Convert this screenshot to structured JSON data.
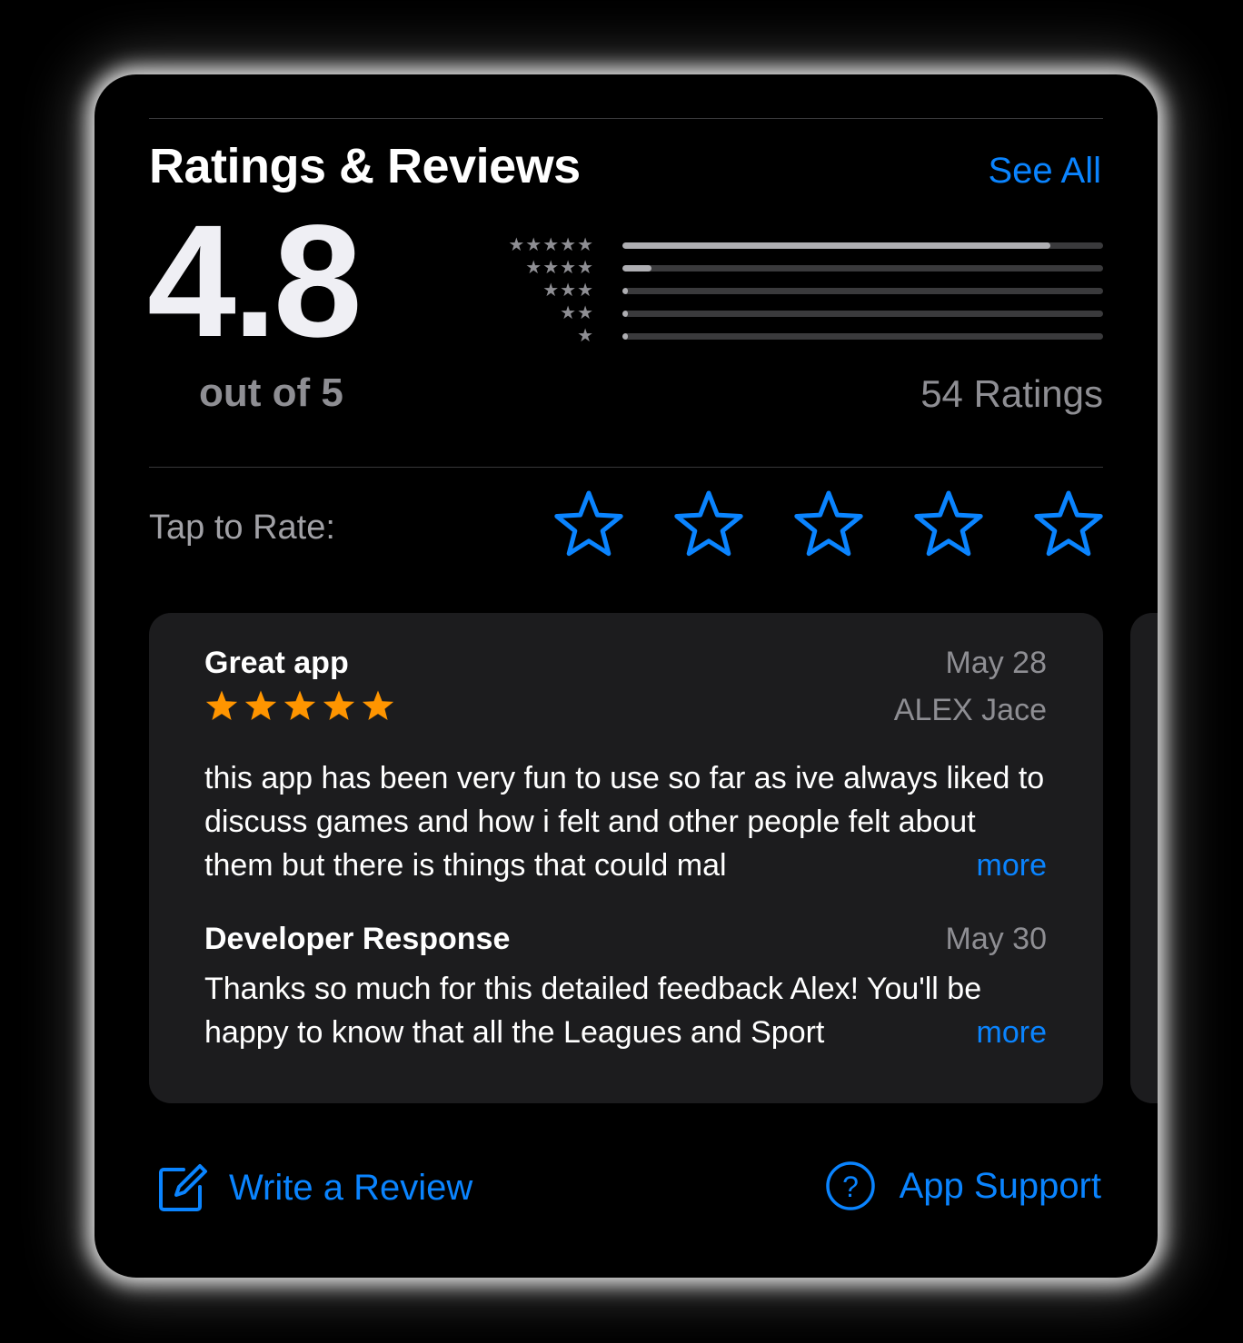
{
  "section": {
    "title": "Ratings & Reviews",
    "see_all_label": "See All"
  },
  "summary": {
    "average": "4.8",
    "out_of_label": "out of 5",
    "count_label": "54 Ratings",
    "distribution": [
      {
        "stars": 5,
        "fraction": 0.89
      },
      {
        "stars": 4,
        "fraction": 0.06
      },
      {
        "stars": 3,
        "fraction": 0.012
      },
      {
        "stars": 2,
        "fraction": 0.012
      },
      {
        "stars": 1,
        "fraction": 0.012
      }
    ]
  },
  "tap_to_rate": {
    "label": "Tap to Rate:",
    "star_count": 5
  },
  "review": {
    "title": "Great app",
    "date": "May 28",
    "author": "ALEX Jace",
    "rating": 5,
    "body": "this app has been very fun to use so far as ive always liked to discuss games and how i felt and other people felt about them but there is things that could mal",
    "more_label": "more",
    "developer_response": {
      "title": "Developer Response",
      "date": "May 30",
      "body": "Thanks so much for this detailed feedback Alex! You'll be happy to know that all the Leagues and Sport",
      "more_label": "more"
    }
  },
  "actions": {
    "write_review_label": "Write a Review",
    "app_support_label": "App Support"
  },
  "colors": {
    "accent": "#0a84ff",
    "star_rating": "#ff9500",
    "secondary_text": "#8e8e93"
  },
  "icons": {
    "write_review": "compose-icon",
    "app_support": "question-circle-icon",
    "star": "star-icon"
  }
}
